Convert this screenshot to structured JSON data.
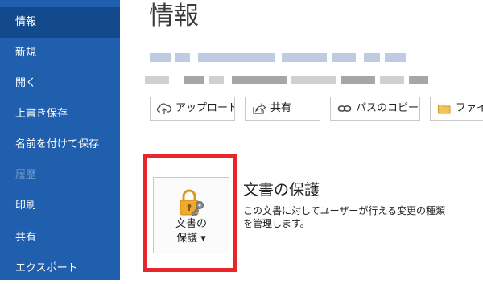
{
  "sidebar": {
    "items": [
      {
        "label": "情報"
      },
      {
        "label": "新規"
      },
      {
        "label": "開く"
      },
      {
        "label": "上書き保存"
      },
      {
        "label": "名前を付けて保存"
      },
      {
        "label": "履歴"
      },
      {
        "label": "印刷"
      },
      {
        "label": "共有"
      },
      {
        "label": "エクスポート"
      }
    ]
  },
  "main": {
    "title": "情報",
    "toolbar": {
      "upload": "アップロード",
      "share": "共有",
      "copy_path": "パスのコピー",
      "file": "ファイル"
    },
    "protect": {
      "button_line1": "文書の",
      "button_line2": "保護 ▾",
      "heading": "文書の保護",
      "description_line1": "この文書に対してユーザーが行える変更の種類",
      "description_line2": "を管理します。"
    }
  },
  "colors": {
    "sidebar_bg": "#1f5fae",
    "sidebar_active": "#134a8e",
    "highlight": "#e8262c",
    "lock": "#f0a92b"
  }
}
